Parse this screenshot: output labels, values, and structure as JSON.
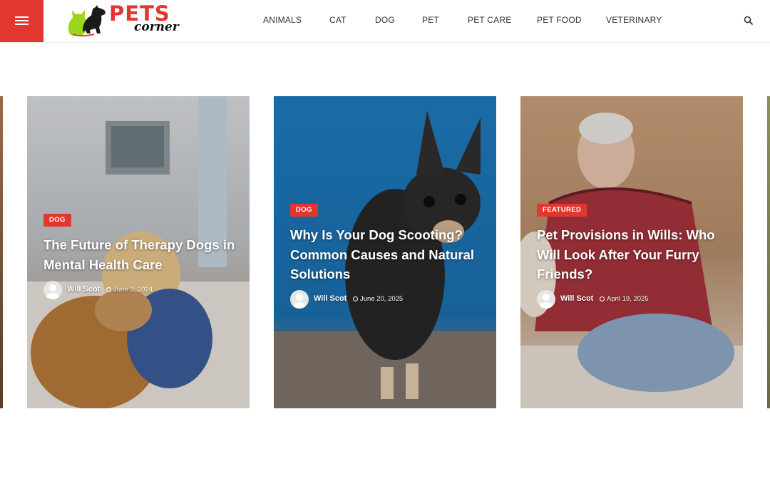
{
  "brand": {
    "name": "PETS",
    "tagline": "corner",
    "accent": "#e2372f"
  },
  "header": {
    "menu_icon": "hamburger-icon",
    "search_icon": "search-icon"
  },
  "nav": [
    {
      "label": "ANIMALS"
    },
    {
      "label": "CAT"
    },
    {
      "label": "DOG"
    },
    {
      "label": "PET"
    },
    {
      "label": "PET CARE"
    },
    {
      "label": "PET FOOD"
    },
    {
      "label": "VETERINARY"
    }
  ],
  "posts": [
    {
      "category": "DOG",
      "title": "The Future of Therapy Dogs in Mental Health Care",
      "author": "Will Scot",
      "date": "June 3, 2024"
    },
    {
      "category": "DOG",
      "title": "Why Is Your Dog Scooting? Common Causes and Natural Solutions",
      "author": "Will Scot",
      "date": "June 20, 2025"
    },
    {
      "category": "FEATURED",
      "title": "Pet Provisions in Wills: Who Will Look After Your Furry Friends?",
      "author": "Will Scot",
      "date": "April 19, 2025"
    }
  ]
}
